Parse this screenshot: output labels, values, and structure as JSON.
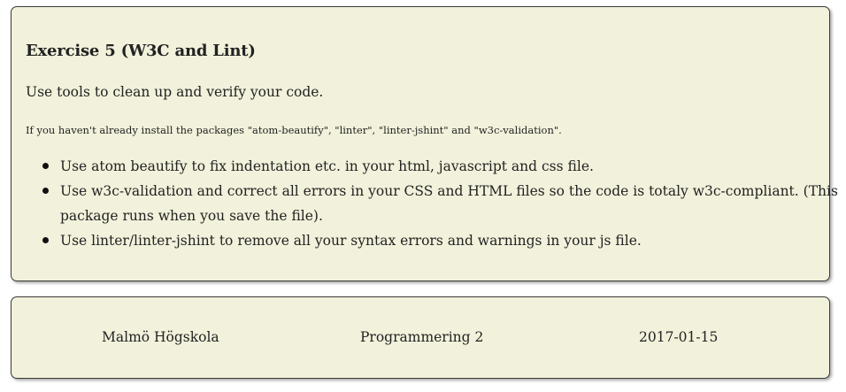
{
  "exercise": {
    "title": "Exercise 5 (W3C and Lint)",
    "lead": "Use tools to clean up and verify your code.",
    "note": "If you haven't already install the packages \"atom-beautify\", \"linter\", \"linter-jshint\" and \"w3c-validation\".",
    "tasks": [
      "Use atom beautify to fix indentation etc. in your html, javascript and css file.",
      "Use w3c-validation and correct all errors in your CSS and HTML files so the code is totaly w3c-compliant. (This package runs when you save the file).",
      "Use linter/linter-jshint to remove all your syntax errors and warnings in your js file."
    ]
  },
  "footer": {
    "school": "Malmö Högskola",
    "course": "Programmering 2",
    "date": "2017-01-15"
  },
  "colors": {
    "card_background": "#f2f2dc",
    "border": "#3a3a3a",
    "text": "#222222"
  }
}
